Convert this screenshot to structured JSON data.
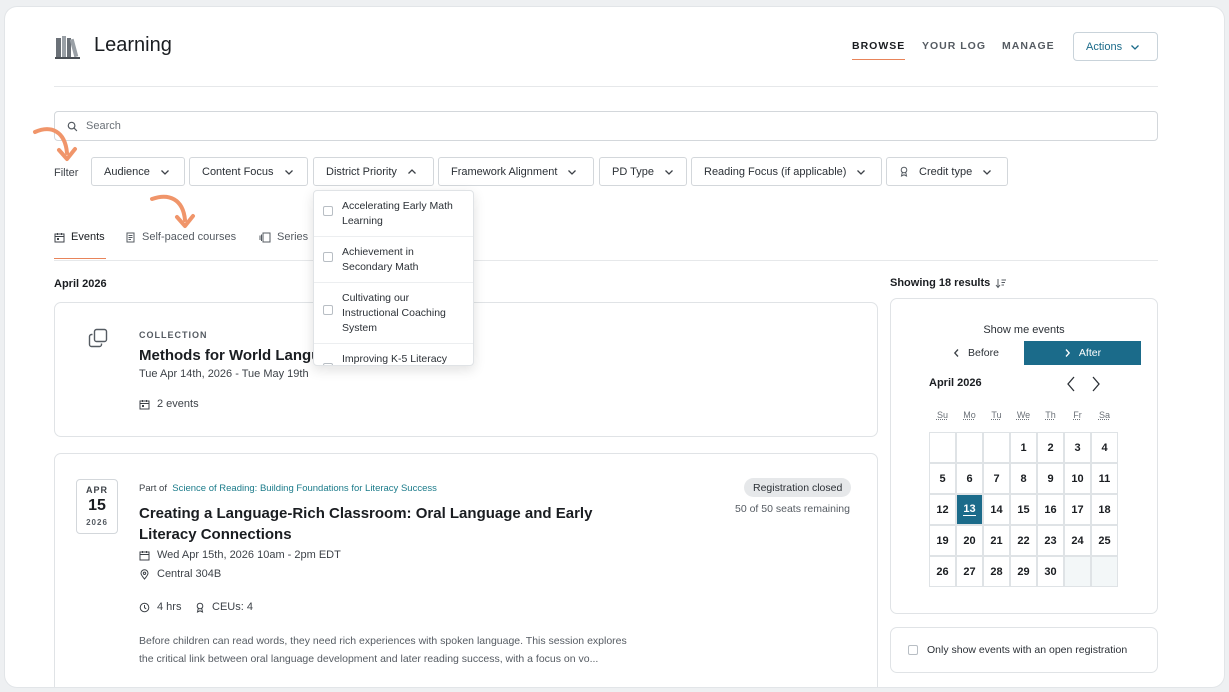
{
  "app": {
    "title": "Learning"
  },
  "nav": [
    {
      "label": "BROWSE",
      "active": true
    },
    {
      "label": "YOUR LOG",
      "active": false
    },
    {
      "label": "MANAGE",
      "active": false
    }
  ],
  "actions": {
    "label": "Actions"
  },
  "search": {
    "placeholder": "Search",
    "value": ""
  },
  "filters": {
    "label": "Filter",
    "chips": [
      {
        "label": "Audience"
      },
      {
        "label": "Content Focus"
      },
      {
        "label": "District Priority",
        "open": true
      },
      {
        "label": "Framework Alignment"
      },
      {
        "label": "PD Type"
      },
      {
        "label": "Reading Focus (if applicable)"
      },
      {
        "label": "Credit type",
        "icon": "award-icon"
      }
    ]
  },
  "dropdown": {
    "options": [
      {
        "label": "Accelerating Early Math Learning",
        "checked": false
      },
      {
        "label": "Achievement in Secondary Math",
        "checked": false
      },
      {
        "label": "Cultivating our Instructional Coaching System",
        "checked": false
      },
      {
        "label": "Improving K-5 Literacy",
        "checked": false
      }
    ]
  },
  "tabs": [
    {
      "label": "Events",
      "icon": "calendar-icon",
      "active": true
    },
    {
      "label": "Self-paced courses",
      "icon": "book-icon",
      "active": false
    },
    {
      "label": "Series",
      "icon": "series-icon",
      "active": false
    }
  ],
  "list": {
    "month": "April 2026",
    "collection": {
      "kicker": "COLLECTION",
      "title": "Methods for World Langu",
      "dates": "Tue Apr 14th, 2026 - Tue May 19th",
      "count": "2 events"
    },
    "event": {
      "date_month": "APR",
      "date_day": "15",
      "date_year": "2026",
      "part_of_label": "Part of",
      "part_of_link": "Science of Reading: Building Foundations for Literacy Success",
      "title": "Creating a Language-Rich Classroom: Oral Language and Early Literacy Connections",
      "when": "Wed Apr 15th, 2026 10am - 2pm EDT",
      "where": "Central 304B",
      "hours": "4 hrs",
      "ceus": "CEUs: 4",
      "status": "Registration closed",
      "seats": "50 of 50 seats remaining",
      "description": "Before children can read words, they need rich experiences with spoken language. This session explores the critical link between oral language development and later reading success, with a focus on vo..."
    }
  },
  "sidebar": {
    "showing": "Showing 18 results",
    "show_me": "Show me events",
    "before": "Before",
    "after": "After",
    "month": "April 2026",
    "weekdays": [
      "Su",
      "Mo",
      "Tu",
      "We",
      "Th",
      "Fr",
      "Sa"
    ],
    "first_weekday_index": 3,
    "days_in_month": 30,
    "today": 13,
    "open_only_label": "Only show events with an open registration",
    "open_only_checked": false
  },
  "colors": {
    "accent": "#1b6b8a",
    "highlight": "#e8845a",
    "link": "#1b7b8a"
  }
}
